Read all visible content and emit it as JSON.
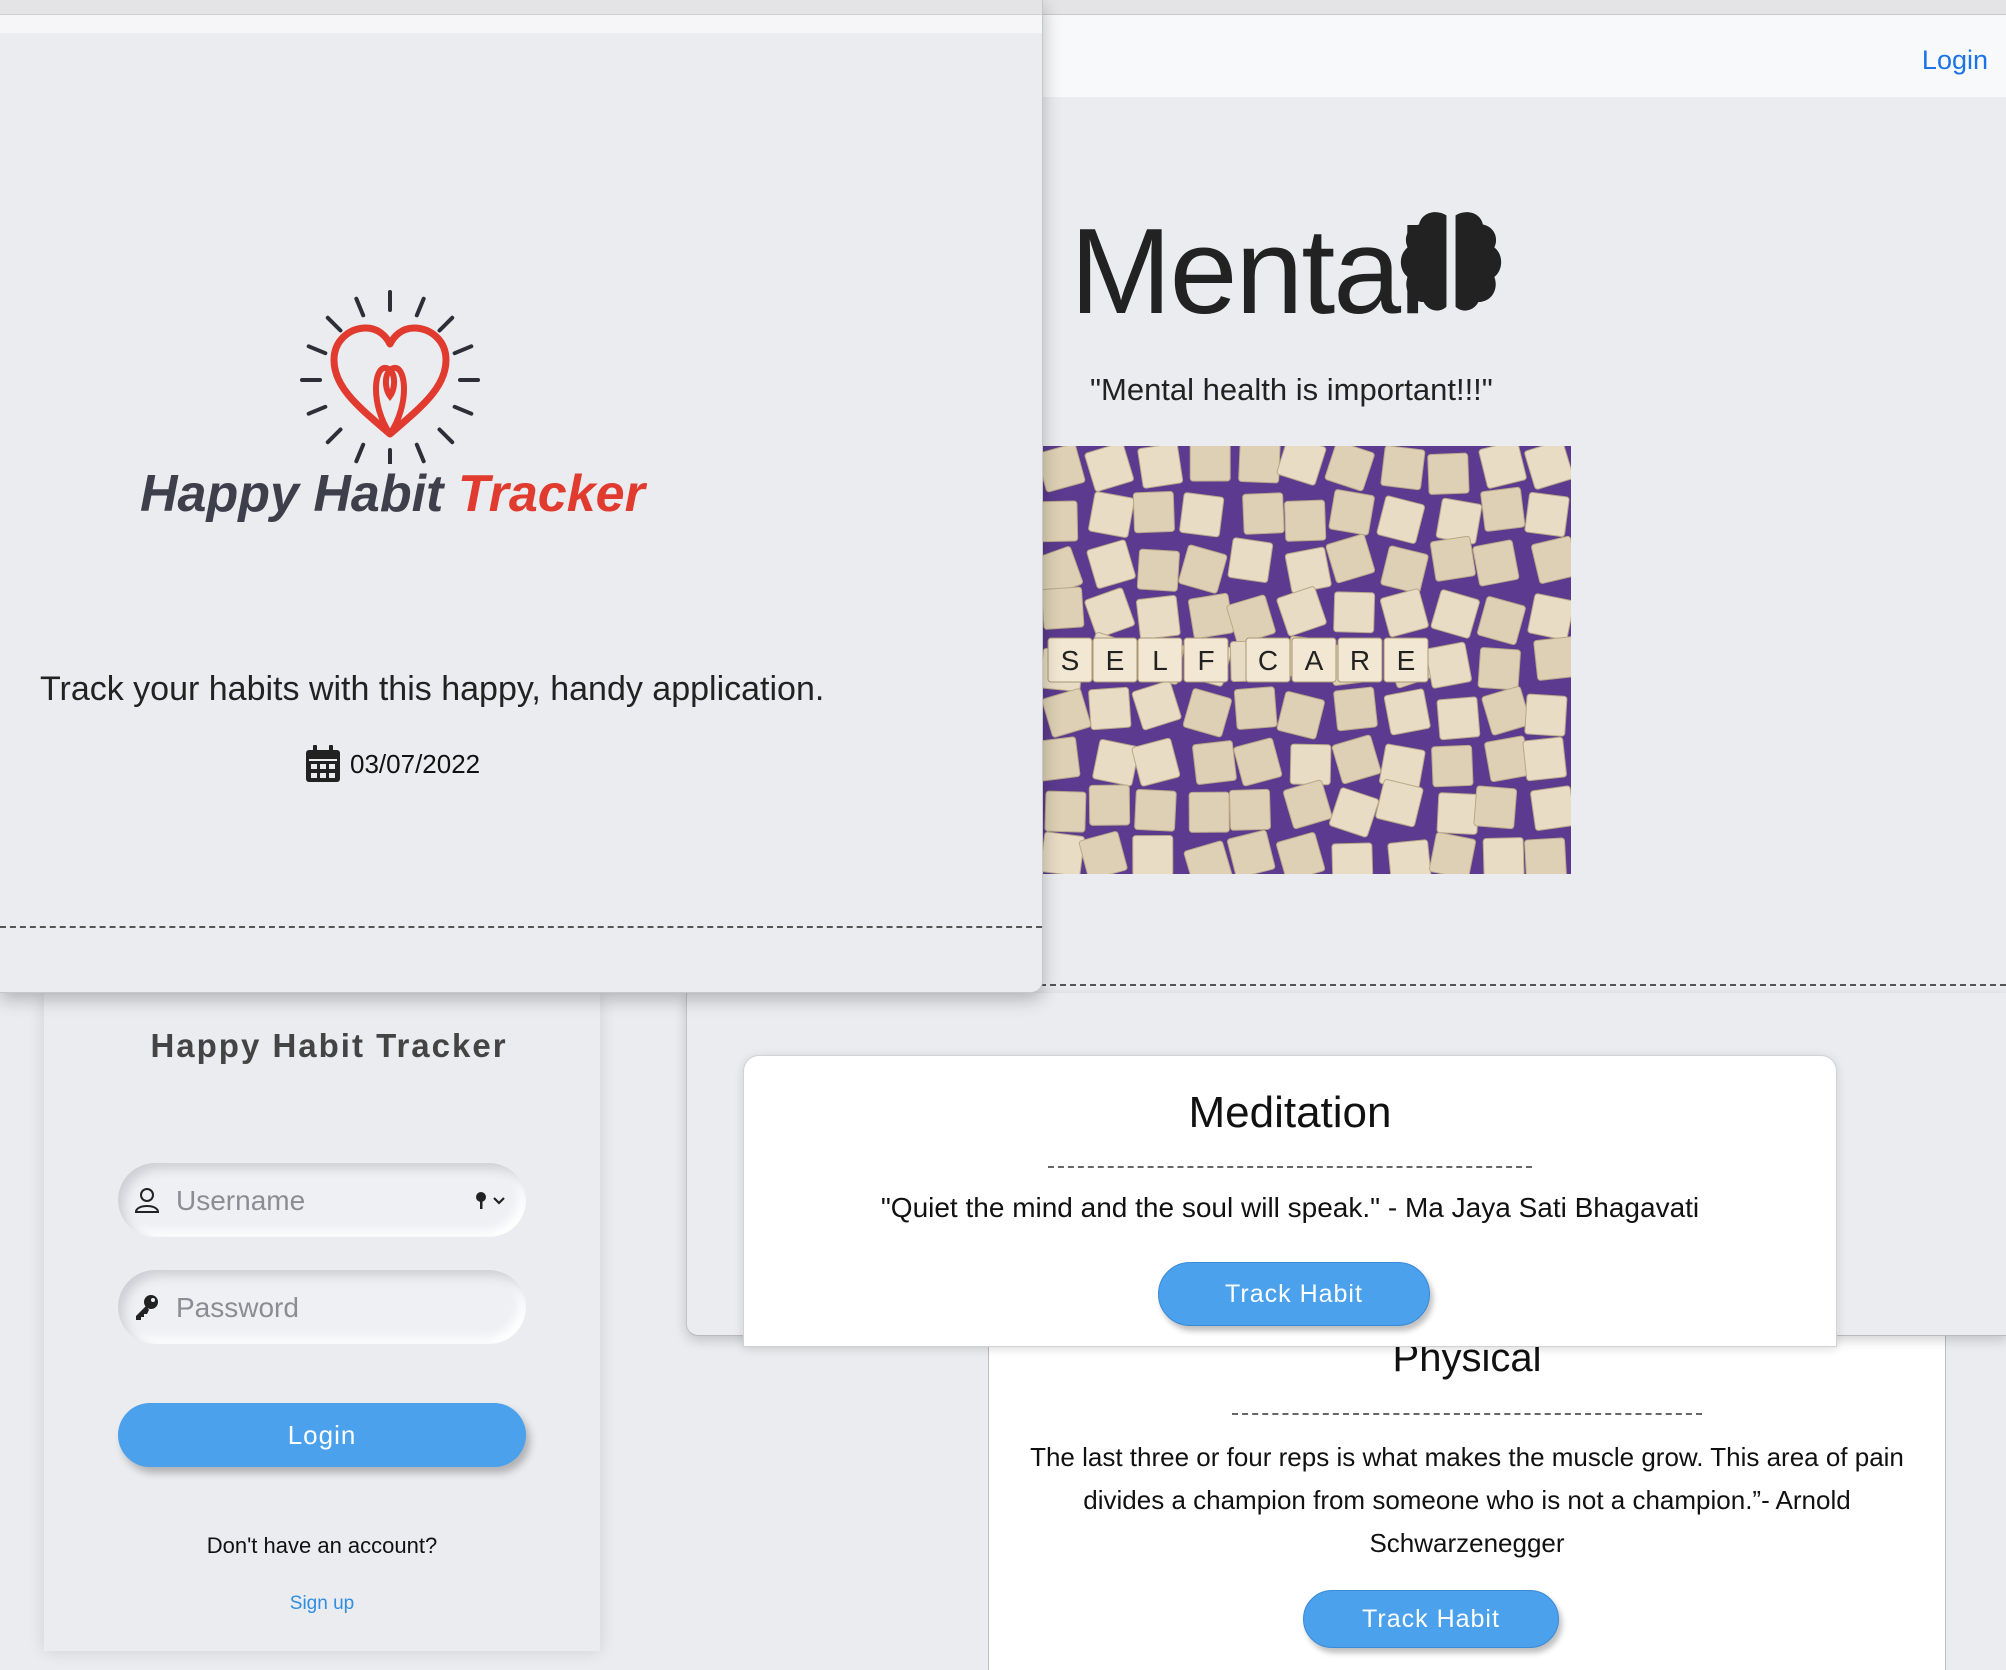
{
  "mental_page": {
    "nav_login": "Login",
    "title": "Mental",
    "quote": "\"Mental health is important!!!\"",
    "image_letters": [
      "S",
      "E",
      "L",
      "F",
      "C",
      "A",
      "R",
      "E"
    ]
  },
  "home_page": {
    "logo_word_1": "Happy Habit",
    "logo_word_2": "Tracker",
    "tagline": "Track your habits with this happy, handy application.",
    "date": "03/07/2022"
  },
  "login": {
    "title": "Happy Habit Tracker",
    "username_placeholder": "Username",
    "password_placeholder": "Password",
    "login_button": "Login",
    "no_account": "Don't have an account?",
    "signup": "Sign up"
  },
  "habits": [
    {
      "title": "Meditation",
      "quote": "\"Quiet the mind and the soul will speak.\" - Ma Jaya Sati Bhagavati",
      "button": "Track Habit"
    },
    {
      "title": "Physical",
      "quote": "The last three or four reps is what makes the muscle grow. This area of pain divides a champion from someone who is not a champion.”- Arnold Schwarzenegger",
      "button": "Track Habit"
    }
  ],
  "colors": {
    "accent": "#4ba1ec",
    "logo_red": "#e03b2e",
    "logo_dark": "#3d3f4a",
    "link_blue": "#1a73e8",
    "image_purple": "#5b3a8f"
  }
}
